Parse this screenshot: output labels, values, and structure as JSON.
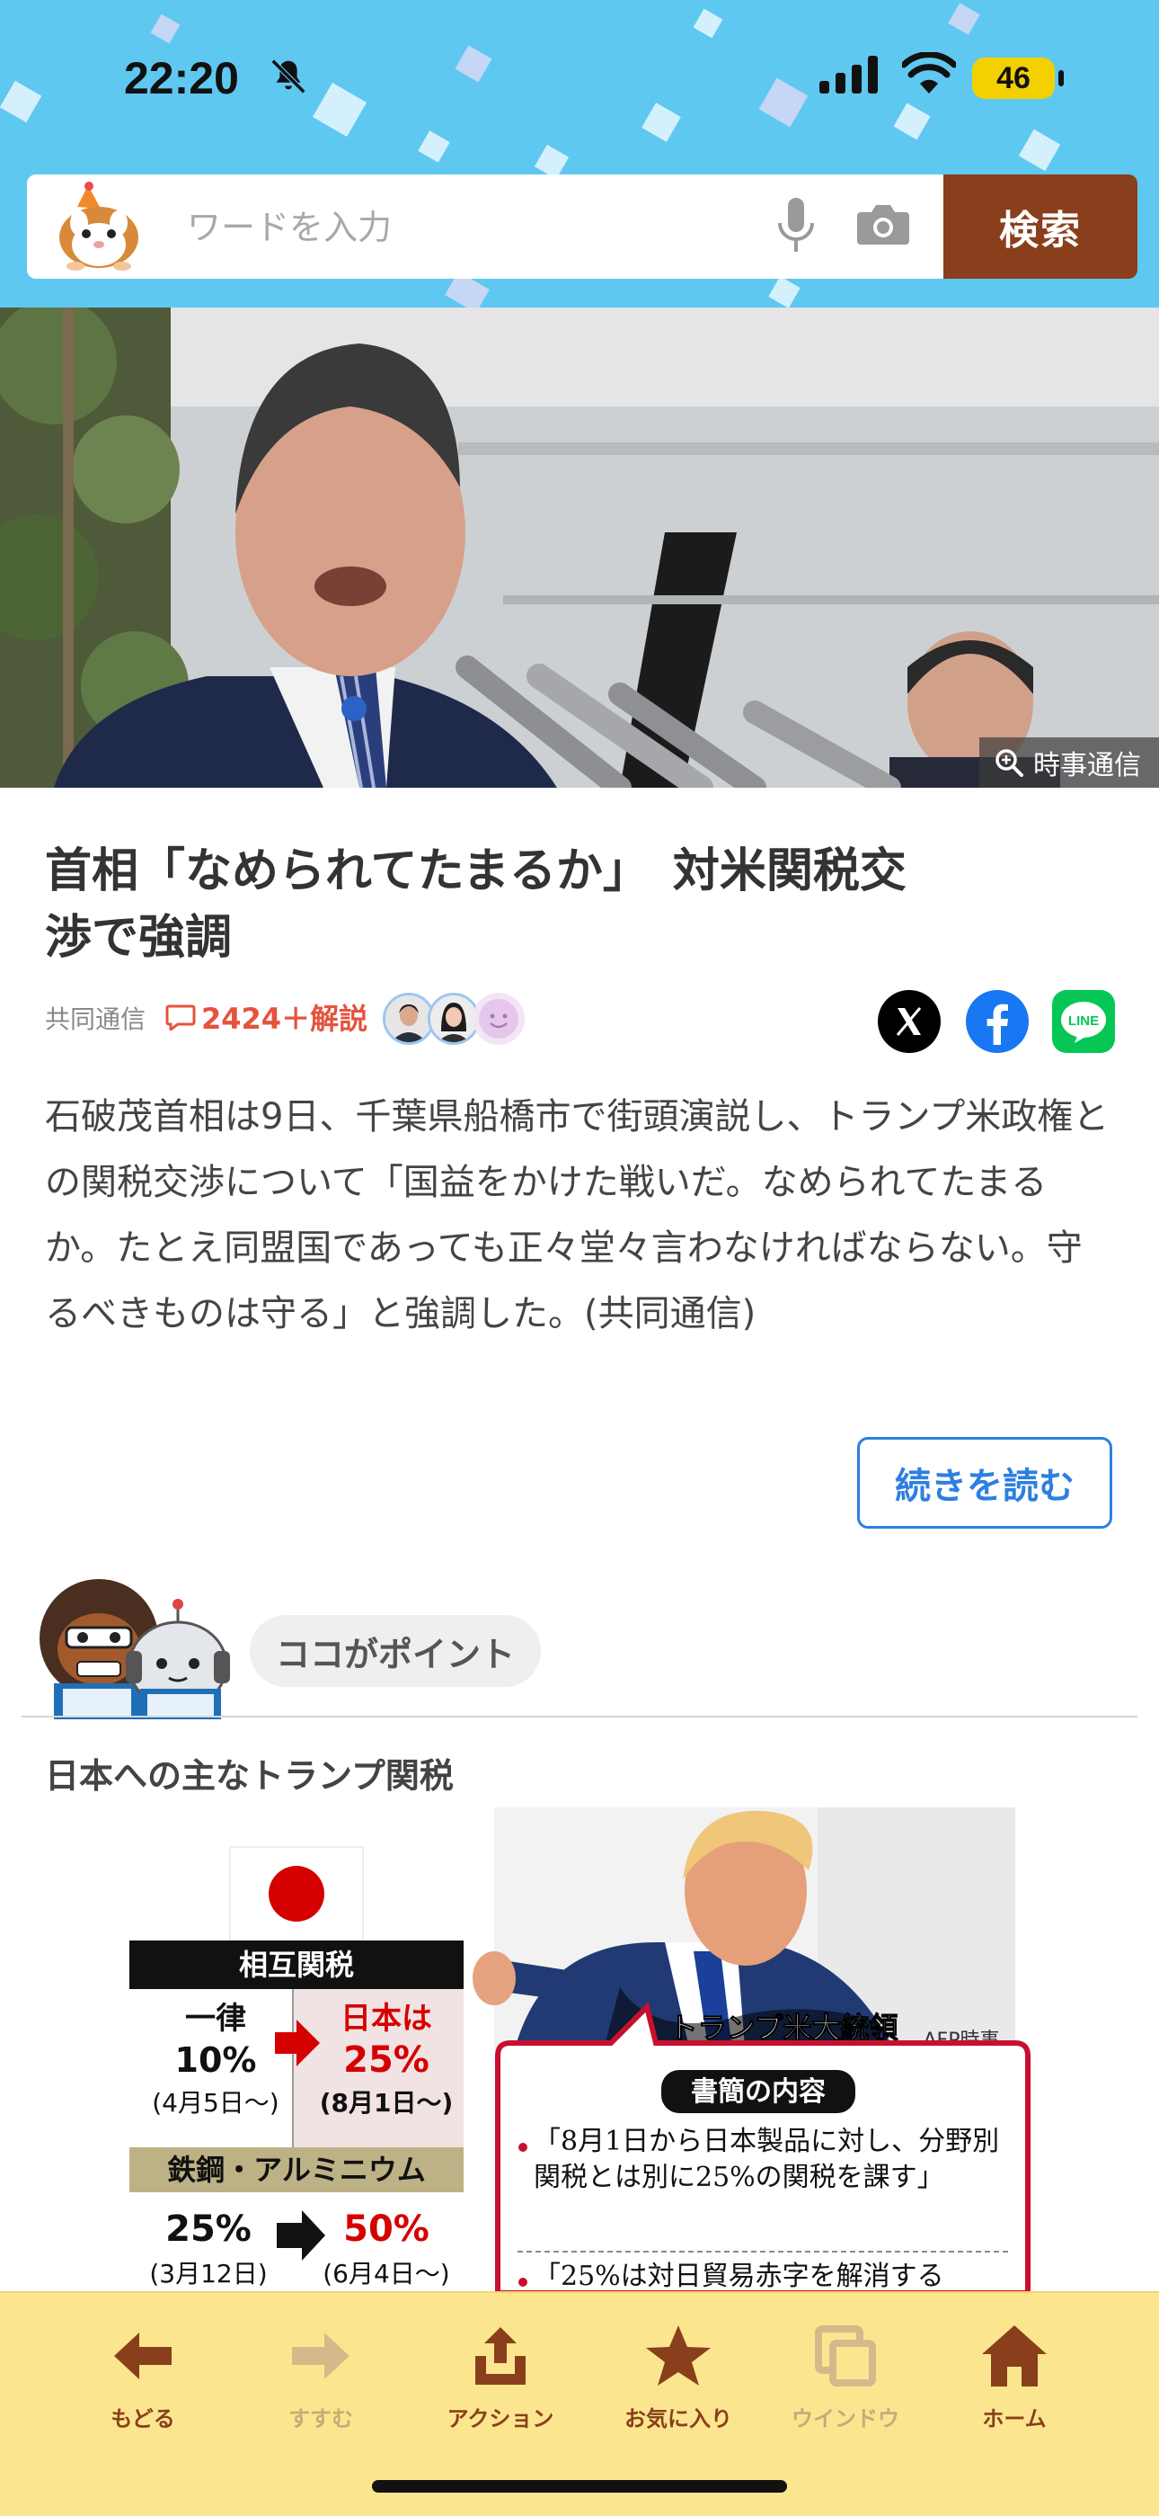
{
  "status_bar": {
    "time": "22:20",
    "battery": "46"
  },
  "search": {
    "placeholder": "ワードを入力",
    "button_label": "検索"
  },
  "hero": {
    "credit": "時事通信"
  },
  "article": {
    "headline": "首相「なめられてたまるか」　対米関税交\n渉で強調",
    "source": "共同通信",
    "comments": "2424＋解説",
    "body": "石破茂首相は9日、千葉県船橋市で街頭演説し、トランプ米政権との関税交渉について「国益をかけた戦いだ。なめられてたまるか。たとえ同盟国であっても正々堂々言わなければならない。守るべきものは守る」と強調した。(共同通信)",
    "read_more": "続きを読む"
  },
  "point": {
    "label": "ココがポイント"
  },
  "section": {
    "title": "日本への主なトランプ関税"
  },
  "infographic": {
    "reciprocal_header": "相互関税",
    "row1_before_label": "一律",
    "row1_before_value": "10%",
    "row1_before_date": "(4月5日〜)",
    "row1_after_label": "日本は",
    "row1_after_value": "25%",
    "row1_after_date": "(8月1日〜)",
    "steel_header": "鉄鋼・アルミニウム",
    "row2_before_value": "25%",
    "row2_before_date": "(3月12日)",
    "row2_after_value": "50%",
    "row2_after_date": "(6月4日〜)",
    "president_caption": "トランプ米大統領",
    "photo_credit": "AFP時事",
    "letter_header": "書簡の内容",
    "letter_item1": "「8月1日から日本製品に対し、分野別関税とは別に25%の関税を課す」",
    "letter_item2": "「25%は対日貿易赤字を解消する"
  },
  "toolbar": {
    "items": [
      {
        "label": "もどる",
        "icon": "arrow-left-icon"
      },
      {
        "label": "すすむ",
        "icon": "arrow-right-icon"
      },
      {
        "label": "アクション",
        "icon": "share-icon"
      },
      {
        "label": "お気に入り",
        "icon": "star-icon"
      },
      {
        "label": "ウインドウ",
        "icon": "windows-icon"
      },
      {
        "label": "ホーム",
        "icon": "home-icon"
      }
    ]
  },
  "colors": {
    "header_bg": "#5fc8f0",
    "search_button": "#8a3f1c",
    "comment_red": "#e5533d",
    "link_blue": "#2d7fe0",
    "toolbar_bg": "#fbe68f",
    "toolbar_icon": "#8a3f1c"
  }
}
